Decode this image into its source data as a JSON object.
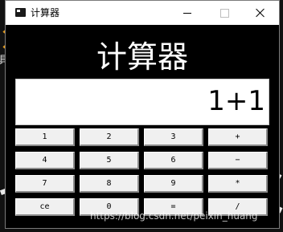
{
  "window": {
    "title": "计算器",
    "minimize_icon": "minimize-icon",
    "maximize_icon": "maximize-icon",
    "close_icon": "close-icon"
  },
  "app": {
    "heading": "计算器",
    "display_value": "1+1"
  },
  "keypad": {
    "rows": [
      [
        "1",
        "2",
        "3",
        "+"
      ],
      [
        "4",
        "5",
        "6",
        "−"
      ],
      [
        "7",
        "8",
        "9",
        "*"
      ],
      [
        "ce",
        "0",
        "=",
        "/"
      ]
    ]
  },
  "background": {
    "side_text": "具"
  },
  "watermark": {
    "text": "https://blog.csdn.net/peixin_huang"
  }
}
